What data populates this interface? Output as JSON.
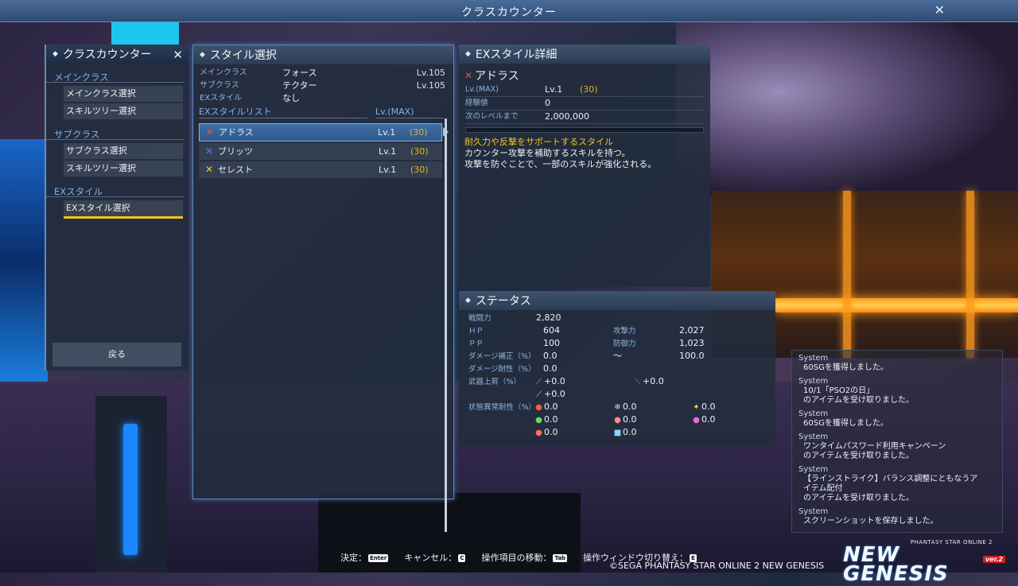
{
  "window": {
    "title": "クラスカウンター",
    "close": "✕"
  },
  "menu": {
    "title": "クラスカウンター",
    "close": "✕",
    "main_cat": "メインクラス",
    "main_items": [
      "メインクラス選択",
      "スキルツリー選択"
    ],
    "sub_cat": "サブクラス",
    "sub_items": [
      "サブクラス選択",
      "スキルツリー選択"
    ],
    "ex_cat": "EXスタイル",
    "ex_items": [
      "EXスタイル選択"
    ],
    "back": "戻る"
  },
  "style": {
    "title": "スタイル選択",
    "main_label": "メインクラス",
    "main_value": "フォース",
    "main_lv": "Lv.105",
    "sub_label": "サブクラス",
    "sub_value": "テクター",
    "sub_lv": "Lv.105",
    "ex_label": "EXスタイル",
    "ex_value": "なし",
    "list_label": "EXスタイルリスト",
    "max_label": "Lv.(MAX)",
    "rows": [
      {
        "icon": "✕",
        "color": "#e05050",
        "name": "アドラス",
        "lv": "Lv.1",
        "max": "(30)"
      },
      {
        "icon": "✕",
        "color": "#4d7ee8",
        "name": "ブリッツ",
        "lv": "Lv.1",
        "max": "(30)"
      },
      {
        "icon": "✕",
        "color": "#e5d030",
        "name": "セレスト",
        "lv": "Lv.1",
        "max": "(30)"
      }
    ]
  },
  "detail": {
    "title": "EXスタイル詳細",
    "name_icon": "✕",
    "name": "アドラス",
    "lvmax_label": "Lv.(MAX)",
    "lv": "Lv.1",
    "max": "(30)",
    "exp_label": "経験値",
    "exp": "0",
    "next_label": "次のレベルまで",
    "next": "2,000,000",
    "desc_title": "耐久力や反撃をサポートするスタイル",
    "desc1": "カウンター攻撃を補助するスキルを持つ。",
    "desc2": "攻撃を防ぐことで、一部のスキルが強化される。",
    "exp_progress": 0
  },
  "status": {
    "title": "ステータス",
    "power_label": "戦闘力",
    "power": "2,820",
    "hp_label": "ＨＰ",
    "hp": "604",
    "atk_label": "攻撃力",
    "atk": "2,027",
    "pp_label": "ＰＰ",
    "pp": "100",
    "def_label": "防御力",
    "def": "1,023",
    "dmg_label": "ダメージ補正（%）",
    "dmg_min": "0.0",
    "tilde": "～",
    "dmg_max": "100.0",
    "res_label": "ダメージ耐性（%）",
    "res": "0.0",
    "weapon_label": "武器上昇（%）",
    "w1": "+0.0",
    "w2": "+0.0",
    "w3": "+0.0",
    "ailment_label": "状態異常耐性（%）",
    "ailments": [
      "0.0",
      "0.0",
      "0.0",
      "0.0",
      "0.0",
      "0.0",
      "0.0",
      "0.0"
    ]
  },
  "log": [
    {
      "src": "System",
      "lines": [
        "60SGを獲得しました。"
      ]
    },
    {
      "src": "System",
      "lines": [
        "10/1「PSO2の日」",
        "のアイテムを受け取りました。"
      ]
    },
    {
      "src": "System",
      "lines": [
        "60SGを獲得しました。"
      ]
    },
    {
      "src": "System",
      "lines": [
        "ワンタイムパスワード利用キャンペーン",
        "のアイテムを受け取りました。"
      ]
    },
    {
      "src": "System",
      "lines": [
        "【ラインストライク】バランス調整にともなうア",
        "イテム配付",
        "のアイテムを受け取りました。"
      ]
    },
    {
      "src": "System",
      "lines": [
        "スクリーンショットを保存しました。"
      ]
    }
  ],
  "footer": {
    "decide": "決定：",
    "decide_key": "Enter",
    "cancel": "キャンセル：",
    "cancel_key": "C",
    "move": "操作項目の移動：",
    "move_key": "Tab",
    "switch": "操作ウィンドウ切り替え：",
    "switch_key": "E",
    "copyright": "©SEGA PHANTASY STAR ONLINE 2 NEW GENESIS"
  },
  "logo": {
    "small": "PHANTASY STAR ONLINE 2",
    "big": "NEW GENESIS",
    "ver": "ver.2"
  }
}
